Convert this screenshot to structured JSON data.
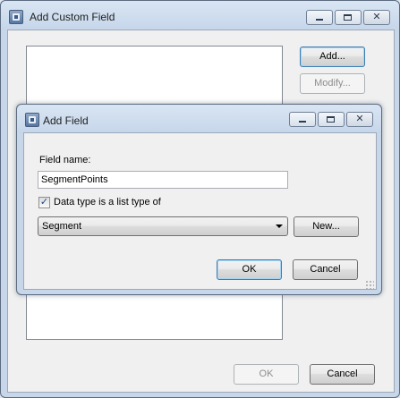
{
  "parent_dialog": {
    "title": "Add Custom Field",
    "buttons": {
      "add": "Add...",
      "modify": "Modify...",
      "ok": "OK",
      "cancel": "Cancel"
    }
  },
  "child_dialog": {
    "title": "Add Field",
    "field_name_label": "Field name:",
    "field_name_value": "SegmentPoints",
    "list_type_checkbox": {
      "label": "Data type is a list type of",
      "checked": true
    },
    "type_combo": {
      "selected": "Segment"
    },
    "buttons": {
      "new": "New...",
      "ok": "OK",
      "cancel": "Cancel"
    }
  },
  "caption_glyphs": {
    "close": "✕"
  }
}
